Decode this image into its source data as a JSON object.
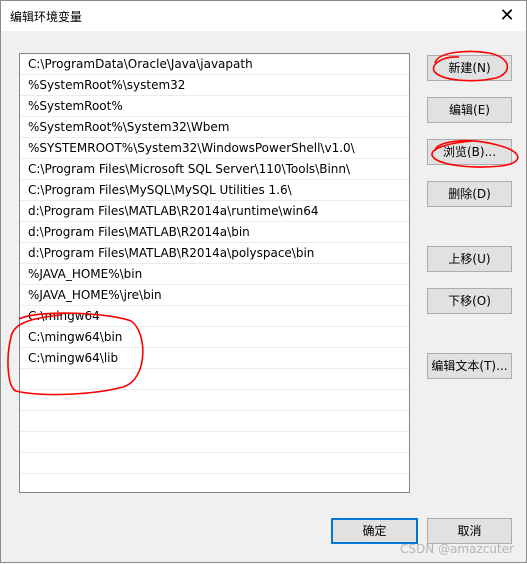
{
  "window": {
    "title": "编辑环境变量",
    "close_glyph": "✕"
  },
  "path_list": [
    "C:\\ProgramData\\Oracle\\Java\\javapath",
    "%SystemRoot%\\system32",
    "%SystemRoot%",
    "%SystemRoot%\\System32\\Wbem",
    "%SYSTEMROOT%\\System32\\WindowsPowerShell\\v1.0\\",
    "C:\\Program Files\\Microsoft SQL Server\\110\\Tools\\Binn\\",
    "C:\\Program Files\\MySQL\\MySQL Utilities 1.6\\",
    "d:\\Program Files\\MATLAB\\R2014a\\runtime\\win64",
    "d:\\Program Files\\MATLAB\\R2014a\\bin",
    "d:\\Program Files\\MATLAB\\R2014a\\polyspace\\bin",
    "%JAVA_HOME%\\bin",
    "%JAVA_HOME%\\jre\\bin",
    "C:\\mingw64",
    "C:\\mingw64\\bin",
    "C:\\mingw64\\lib",
    "",
    "",
    "",
    "",
    "",
    ""
  ],
  "buttons": {
    "new": "新建(N)",
    "edit": "编辑(E)",
    "browse": "浏览(B)...",
    "delete": "删除(D)",
    "move_up": "上移(U)",
    "move_down": "下移(O)",
    "edit_text": "编辑文本(T)...",
    "ok": "确定",
    "cancel": "取消"
  },
  "annotation_color": "#ff0000",
  "watermark": "CSDN @amazcuter"
}
